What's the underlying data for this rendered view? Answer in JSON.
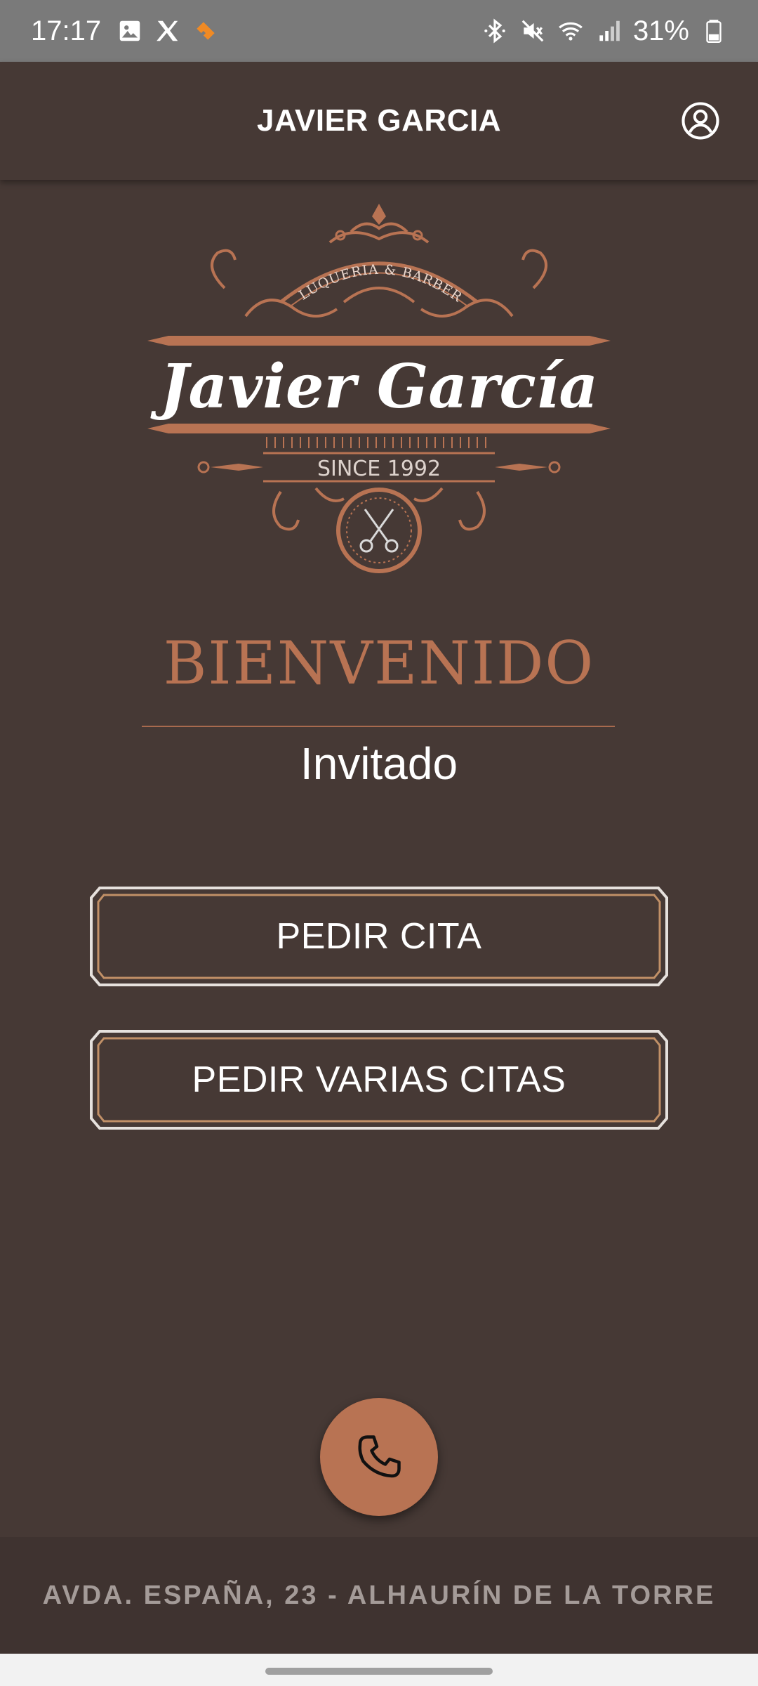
{
  "status_bar": {
    "time": "17:17",
    "battery": "31%",
    "left_icons": [
      "gallery-icon",
      "x-icon",
      "wallapop-icon"
    ],
    "right_icons": [
      "bluetooth-icon",
      "mute-icon",
      "wifi-icon",
      "signal-icon",
      "battery-icon"
    ]
  },
  "app_bar": {
    "title": "JAVIER GARCIA",
    "account_icon": "account-circle-icon"
  },
  "logo": {
    "top_text": "PELUQUERIA & BARBERIA",
    "name": "Javier García",
    "since": "SINCE 1992"
  },
  "main": {
    "welcome": "BIENVENIDO",
    "guest": "Invitado"
  },
  "buttons": {
    "book": "PEDIR CITA",
    "book_multiple": "PEDIR VARIAS CITAS"
  },
  "fab": {
    "icon": "phone-icon"
  },
  "footer": {
    "address": "AVDA. ESPAÑA, 23 - ALHAURÍN DE LA TORRE"
  },
  "colors": {
    "background": "#463935",
    "accent": "#b87353",
    "status_bar": "#7a7a7a",
    "footer": "#3f3330",
    "footer_text": "#a49b98"
  }
}
